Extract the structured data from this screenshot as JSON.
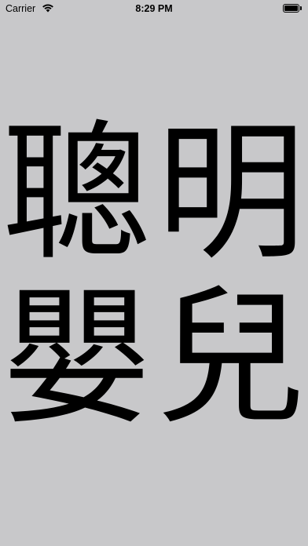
{
  "status_bar": {
    "carrier": "Carrier",
    "time": "8:29 PM",
    "battery_level": 1.0,
    "wifi_icon": "wifi-icon",
    "battery_icon": "battery-icon"
  },
  "characters": {
    "row1": [
      "聰",
      "明"
    ],
    "row2": [
      "嬰",
      "兒"
    ]
  },
  "colors": {
    "background": "#c8c8ca",
    "text": "#000000"
  }
}
